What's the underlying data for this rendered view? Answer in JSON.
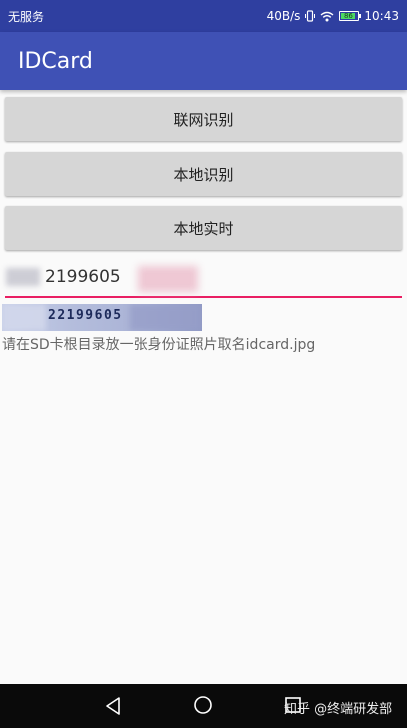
{
  "status_bar": {
    "carrier": "无服务",
    "speed": "40B/s",
    "battery_level": "86",
    "time": "10:43"
  },
  "app_bar": {
    "title": "IDCard"
  },
  "buttons": [
    {
      "label": "联网识别"
    },
    {
      "label": "本地识别"
    },
    {
      "label": "本地实时"
    }
  ],
  "id_input": {
    "value": "2199605"
  },
  "card_crop": {
    "digits": "22199605"
  },
  "hint": "请在SD卡根目录放一张身份证照片取名idcard.jpg",
  "watermark": "知乎 @终端研发部",
  "colors": {
    "status_bar": "#2f3fa0",
    "app_bar": "#3f51b5",
    "input_underline": "#e91e63",
    "button_bg": "#d6d6d6",
    "nav_bar": "#0a0a0a"
  },
  "icons": [
    "vibrate-icon",
    "wifi-icon",
    "battery-icon",
    "nav-back-icon",
    "nav-home-icon",
    "nav-recent-icon"
  ]
}
